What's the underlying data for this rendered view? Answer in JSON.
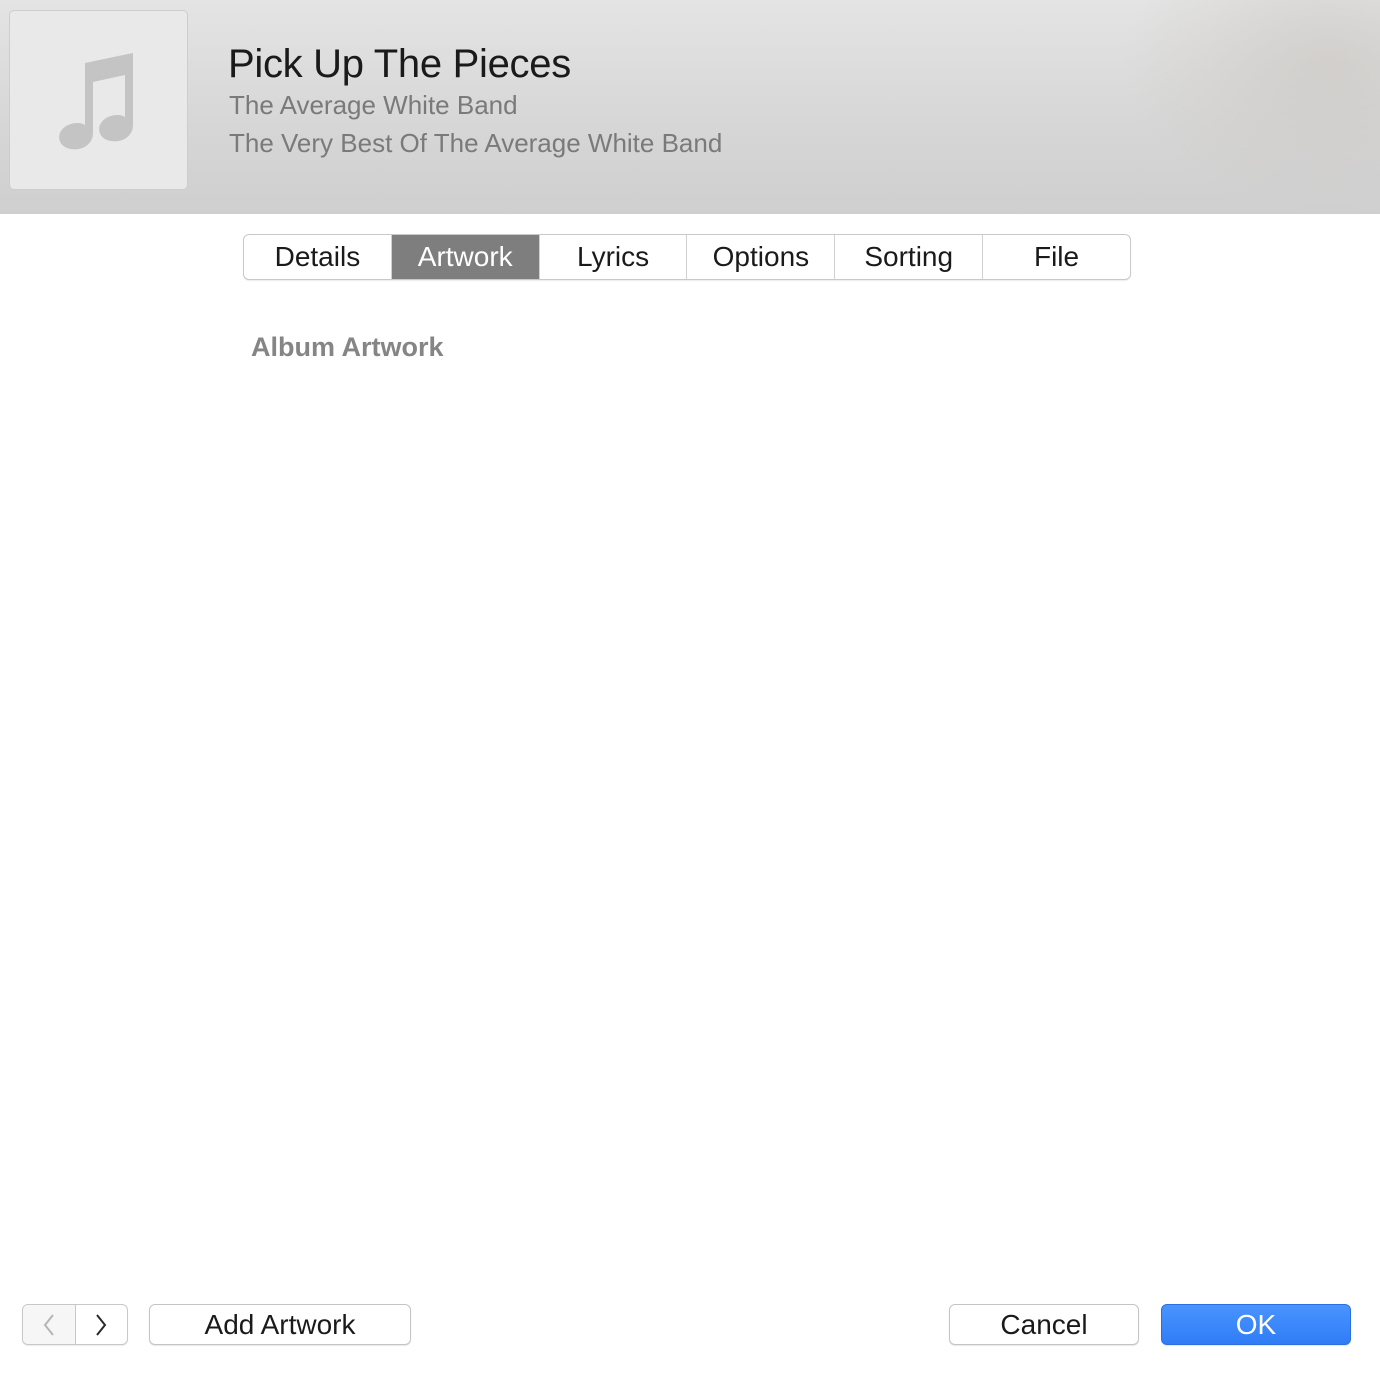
{
  "header": {
    "title": "Pick Up The Pieces",
    "artist": "The Average White Band",
    "album": "The Very Best Of The Average White Band",
    "artwork_icon": "music-note-icon"
  },
  "tabs": [
    {
      "label": "Details",
      "active": false
    },
    {
      "label": "Artwork",
      "active": true
    },
    {
      "label": "Lyrics",
      "active": false
    },
    {
      "label": "Options",
      "active": false
    },
    {
      "label": "Sorting",
      "active": false
    },
    {
      "label": "File",
      "active": false
    }
  ],
  "content": {
    "section_label": "Album Artwork"
  },
  "footer": {
    "previous_icon": "chevron-left-icon",
    "next_icon": "chevron-right-icon",
    "add_artwork_label": "Add Artwork",
    "cancel_label": "Cancel",
    "ok_label": "OK"
  },
  "colors": {
    "active_tab": "#7e7e7e",
    "ok_button": "#3a86fb",
    "header_bg": "#d9d9d9"
  }
}
